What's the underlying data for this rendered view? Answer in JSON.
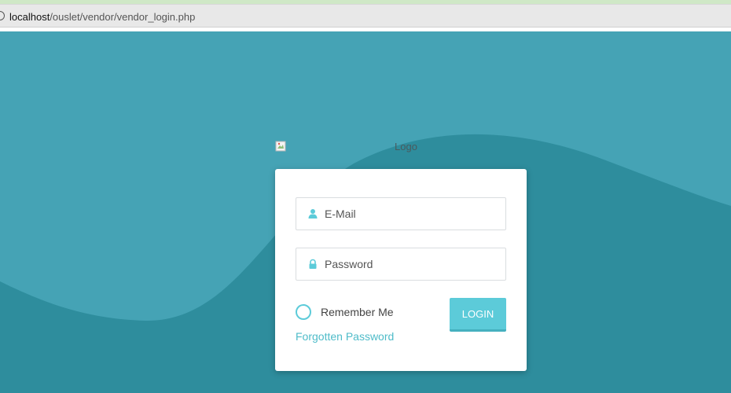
{
  "browser": {
    "url_host": "localhost",
    "url_path": "/ouslet/vendor/vendor_login.php"
  },
  "logo": {
    "alt": "Logo"
  },
  "login_form": {
    "email_placeholder": "E-Mail",
    "password_placeholder": "Password",
    "remember_label": "Remember Me",
    "login_button": "LOGIN",
    "forgot_link": "Forgotten Password"
  },
  "colors": {
    "background": "#45a3b5",
    "wave": "#2e8d9d",
    "accent": "#5ccbd9"
  }
}
